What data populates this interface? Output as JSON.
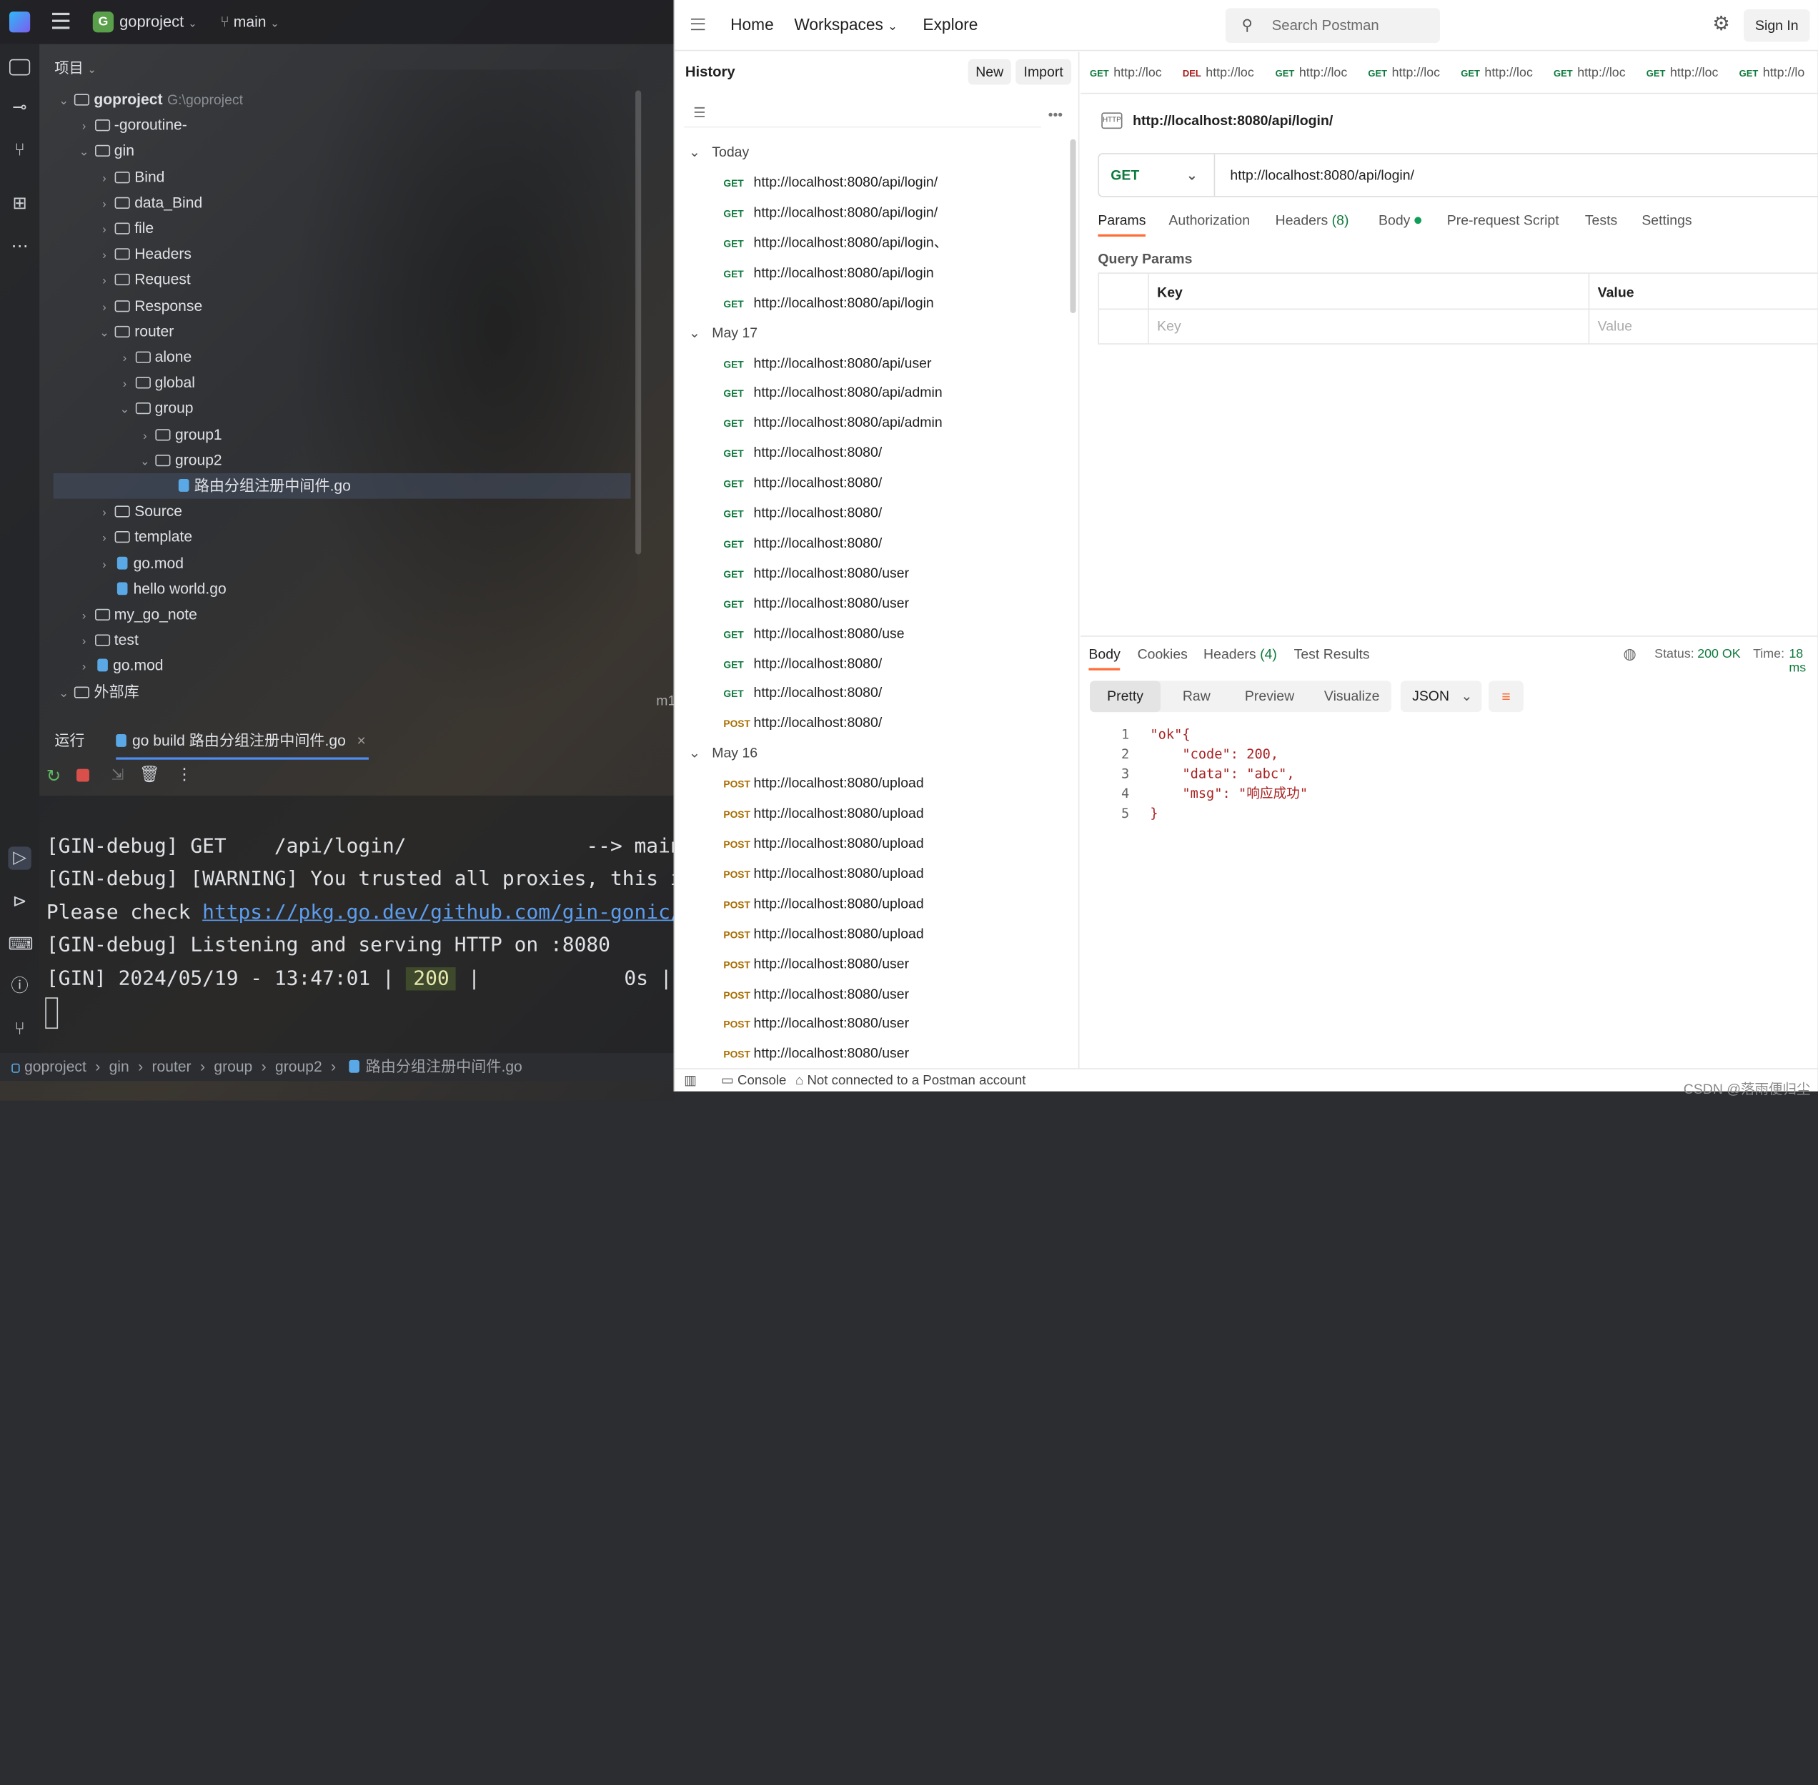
{
  "ide": {
    "project_badge": "G",
    "project_name": "goproject",
    "branch": "main",
    "panel_title": "项目",
    "tree": [
      {
        "label": "goproject",
        "hint": "G:\\goproject",
        "depth": 0,
        "open": true,
        "kind": "folder"
      },
      {
        "label": "-goroutine-",
        "depth": 1,
        "open": false,
        "kind": "folder"
      },
      {
        "label": "gin",
        "depth": 1,
        "open": true,
        "kind": "folder"
      },
      {
        "label": "Bind",
        "depth": 2,
        "open": false,
        "kind": "folder"
      },
      {
        "label": "data_Bind",
        "depth": 2,
        "open": false,
        "kind": "folder"
      },
      {
        "label": "file",
        "depth": 2,
        "open": false,
        "kind": "folder"
      },
      {
        "label": "Headers",
        "depth": 2,
        "open": false,
        "kind": "folder"
      },
      {
        "label": "Request",
        "depth": 2,
        "open": false,
        "kind": "folder"
      },
      {
        "label": "Response",
        "depth": 2,
        "open": false,
        "kind": "folder"
      },
      {
        "label": "router",
        "depth": 2,
        "open": true,
        "kind": "folder"
      },
      {
        "label": "alone",
        "depth": 3,
        "open": false,
        "kind": "folder"
      },
      {
        "label": "global",
        "depth": 3,
        "open": false,
        "kind": "folder"
      },
      {
        "label": "group",
        "depth": 3,
        "open": true,
        "kind": "folder"
      },
      {
        "label": "group1",
        "depth": 4,
        "open": false,
        "kind": "folder"
      },
      {
        "label": "group2",
        "depth": 4,
        "open": true,
        "kind": "folder"
      },
      {
        "label": "路由分组注册中间件.go",
        "depth": 5,
        "kind": "file",
        "selected": true
      },
      {
        "label": "Source",
        "depth": 2,
        "open": false,
        "kind": "folder"
      },
      {
        "label": "template",
        "depth": 2,
        "open": false,
        "kind": "folder"
      },
      {
        "label": "go.mod",
        "depth": 2,
        "open": false,
        "kind": "mod"
      },
      {
        "label": "hello world.go",
        "depth": 2,
        "kind": "file"
      },
      {
        "label": "my_go_note",
        "depth": 1,
        "open": false,
        "kind": "folder"
      },
      {
        "label": "test",
        "depth": 1,
        "open": false,
        "kind": "folder"
      },
      {
        "label": "go.mod",
        "depth": 1,
        "open": false,
        "kind": "mod"
      },
      {
        "label": "外部库",
        "depth": 0,
        "open": true,
        "kind": "lib"
      }
    ],
    "run_label": "运行",
    "run_tab": "go build 路由分组注册中间件.go",
    "console_lines": [
      {
        "text": "[GIN-debug] GET    /api/login/               --> main"
      },
      {
        "text": "[GIN-debug] [WARNING] You trusted all proxies, this i"
      },
      {
        "prefix": "Please check ",
        "link": "https://pkg.go.dev/github.com/gin-gonic/"
      },
      {
        "text": "[GIN-debug] Listening and serving HTTP on :8080"
      },
      {
        "prefix": "[GIN] 2024/05/19 - 13:47:01 | ",
        "status": "200",
        "suffix": " |            0s |"
      }
    ],
    "breadcrumb": [
      "goproject",
      "gin",
      "router",
      "group",
      "group2",
      "路由分组注册中间件.go"
    ],
    "editor_gutter": "m1"
  },
  "postman": {
    "nav": {
      "home": "Home",
      "workspaces": "Workspaces",
      "explore": "Explore",
      "search_placeholder": "Search Postman",
      "sign_in": "Sign In"
    },
    "history": {
      "title": "History",
      "new_label": "New",
      "import_label": "Import",
      "groups": [
        {
          "name": "Today",
          "items": [
            {
              "m": "GET",
              "u": "http://localhost:8080/api/login/"
            },
            {
              "m": "GET",
              "u": "http://localhost:8080/api/login/"
            },
            {
              "m": "GET",
              "u": "http://localhost:8080/api/login、"
            },
            {
              "m": "GET",
              "u": "http://localhost:8080/api/login"
            },
            {
              "m": "GET",
              "u": "http://localhost:8080/api/login"
            }
          ]
        },
        {
          "name": "May 17",
          "items": [
            {
              "m": "GET",
              "u": "http://localhost:8080/api/user"
            },
            {
              "m": "GET",
              "u": "http://localhost:8080/api/admin"
            },
            {
              "m": "GET",
              "u": "http://localhost:8080/api/admin"
            },
            {
              "m": "GET",
              "u": "http://localhost:8080/"
            },
            {
              "m": "GET",
              "u": "http://localhost:8080/"
            },
            {
              "m": "GET",
              "u": "http://localhost:8080/"
            },
            {
              "m": "GET",
              "u": "http://localhost:8080/"
            },
            {
              "m": "GET",
              "u": "http://localhost:8080/user"
            },
            {
              "m": "GET",
              "u": "http://localhost:8080/user"
            },
            {
              "m": "GET",
              "u": "http://localhost:8080/use"
            },
            {
              "m": "GET",
              "u": "http://localhost:8080/"
            },
            {
              "m": "GET",
              "u": "http://localhost:8080/"
            },
            {
              "m": "POST",
              "u": "http://localhost:8080/"
            }
          ]
        },
        {
          "name": "May 16",
          "items": [
            {
              "m": "POST",
              "u": "http://localhost:8080/upload"
            },
            {
              "m": "POST",
              "u": "http://localhost:8080/upload"
            },
            {
              "m": "POST",
              "u": "http://localhost:8080/upload"
            },
            {
              "m": "POST",
              "u": "http://localhost:8080/upload"
            },
            {
              "m": "POST",
              "u": "http://localhost:8080/upload"
            },
            {
              "m": "POST",
              "u": "http://localhost:8080/upload"
            },
            {
              "m": "POST",
              "u": "http://localhost:8080/user"
            },
            {
              "m": "POST",
              "u": "http://localhost:8080/user"
            },
            {
              "m": "POST",
              "u": "http://localhost:8080/user"
            },
            {
              "m": "POST",
              "u": "http://localhost:8080/user"
            }
          ]
        }
      ]
    },
    "req_tabs": [
      {
        "m": "GET",
        "u": "http://loc"
      },
      {
        "m": "DEL",
        "u": "http://loc"
      },
      {
        "m": "GET",
        "u": "http://loc"
      },
      {
        "m": "GET",
        "u": "http://loc"
      },
      {
        "m": "GET",
        "u": "http://loc"
      },
      {
        "m": "GET",
        "u": "http://loc"
      },
      {
        "m": "GET",
        "u": "http://loc"
      },
      {
        "m": "GET",
        "u": "http://lo"
      }
    ],
    "request": {
      "badge": "HTTP",
      "title": "http://localhost:8080/api/login/",
      "method": "GET",
      "url": "http://localhost:8080/api/login/",
      "tabs": [
        "Params",
        "Authorization",
        "Headers",
        "Body",
        "Pre-request Script",
        "Tests",
        "Settings"
      ],
      "headers_count": "(8)",
      "query_params_label": "Query Params",
      "col_key": "Key",
      "col_value": "Value",
      "key_placeholder": "Key",
      "value_placeholder": "Value"
    },
    "response": {
      "tabs": [
        "Body",
        "Cookies",
        "Headers",
        "Test Results"
      ],
      "headers_count": "(4)",
      "status_label": "Status:",
      "status": "200 OK",
      "time_label": "Time:",
      "time": "18 ms",
      "views": [
        "Pretty",
        "Raw",
        "Preview",
        "Visualize"
      ],
      "format": "JSON",
      "lines": [
        "\"ok\"{",
        "    \"code\": 200,",
        "    \"data\": \"abc\",",
        "    \"msg\": \"响应成功\"",
        "}"
      ]
    },
    "footer": {
      "console": "Console",
      "account": "Not connected to a Postman account"
    }
  },
  "watermark": "CSDN @落雨便归尘",
  "colors": {
    "get": "#0f7a3c",
    "post": "#a86d00",
    "del": "#a61b1b",
    "accent": "#ff6c37"
  }
}
